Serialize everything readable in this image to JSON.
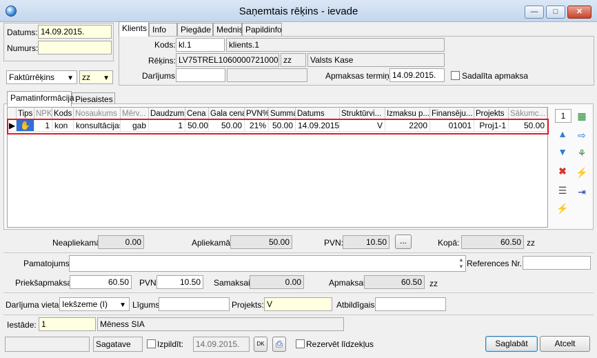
{
  "window": {
    "title": "Saņemtais rēķins - ievade"
  },
  "left": {
    "datums_label": "Datums:",
    "datums_value": "14.09.2015.",
    "numurs_label": "Numurs:",
    "numurs_value": "",
    "doc_type": "Faktūrrēķins",
    "currency": "zz"
  },
  "tabs_top": [
    "Klients",
    "Info",
    "Piegāde",
    "Mednis",
    "Papildinfo"
  ],
  "klients": {
    "kods_label": "Kods:",
    "kods_value": "kl.1",
    "kods_name": "klients.1",
    "rekins_label": "Rēķins:",
    "rekins_value": "LV75TREL1060000721000",
    "rekins_cur": "zz",
    "rekins_bank": "Valsts Kase",
    "darijums_label": "Darījums:",
    "termins_label": "Apmaksas termiņš:",
    "termins_value": "14.09.2015.",
    "sadalita_label": "Sadalīta apmaksa"
  },
  "tabs_mid": [
    "Pamatinformācija",
    "Piesaistes"
  ],
  "grid": {
    "headers": [
      "Tips",
      "NPK",
      "Kods",
      "Nosaukums",
      "Mērv...",
      "Daudzums",
      "Cena",
      "Gala cena",
      "PVN%",
      "Summa",
      "Datums",
      "Struktūrvi...",
      "Izmaksu p...",
      "Finansēju...",
      "Projekts",
      "Sākumc..."
    ],
    "row": [
      "",
      "1",
      "kon",
      "konsultācijas",
      "gab",
      "1",
      "50.00",
      "50.00",
      "21%",
      "50.00",
      "14.09.2015.",
      "V",
      "2200",
      "01001",
      "Proj1-1",
      "50.00"
    ],
    "counter": "1"
  },
  "totals": {
    "neapliekama_label": "Neapliekamā:",
    "neapliekama_value": "0.00",
    "apliekama_label": "Apliekamā:",
    "apliekama_value": "50.00",
    "pvn_label": "PVN:",
    "pvn_value": "10.50",
    "dots": "...",
    "kopa_label": "Kopā:",
    "kopa_value": "60.50",
    "kopa_cur": "zz"
  },
  "pamatojums_label": "Pamatojums:",
  "references_label": "References Nr.:",
  "payment": {
    "priekssapmaksa_label": "Priekšapmaksa :",
    "priekssapmaksa_value": "60.50",
    "pvn_label": "PVN:",
    "pvn_value": "10.50",
    "samaksai_label": "Samaksai:",
    "samaksai_value": "0.00",
    "apmaksai_label": "Apmaksai:",
    "apmaksai_value": "60.50",
    "cur": "zz"
  },
  "deal": {
    "vieta_label": "Darījuma vieta:",
    "vieta_value": "Iekšzeme (I)",
    "ligums_label": "Līgums:",
    "projekts_label": "Projekts:",
    "projekts_value": "V",
    "atbildigais_label": "Atbildīgais:"
  },
  "iestade": {
    "label": "Iestāde:",
    "code": "1",
    "name": "Mēness SIA"
  },
  "footer": {
    "status": "Sagatave",
    "izpildit_label": "Izpildīt:",
    "izpildit_date": "14.09.2015.",
    "dk_label": "DK",
    "rezervet_label": "Rezervēt līdzekļus",
    "save": "Saglabāt",
    "cancel": "Atcelt"
  },
  "colors": {
    "highlight": "#e01b24",
    "required": "#ffffe1",
    "accent": "#3c7fb1"
  }
}
